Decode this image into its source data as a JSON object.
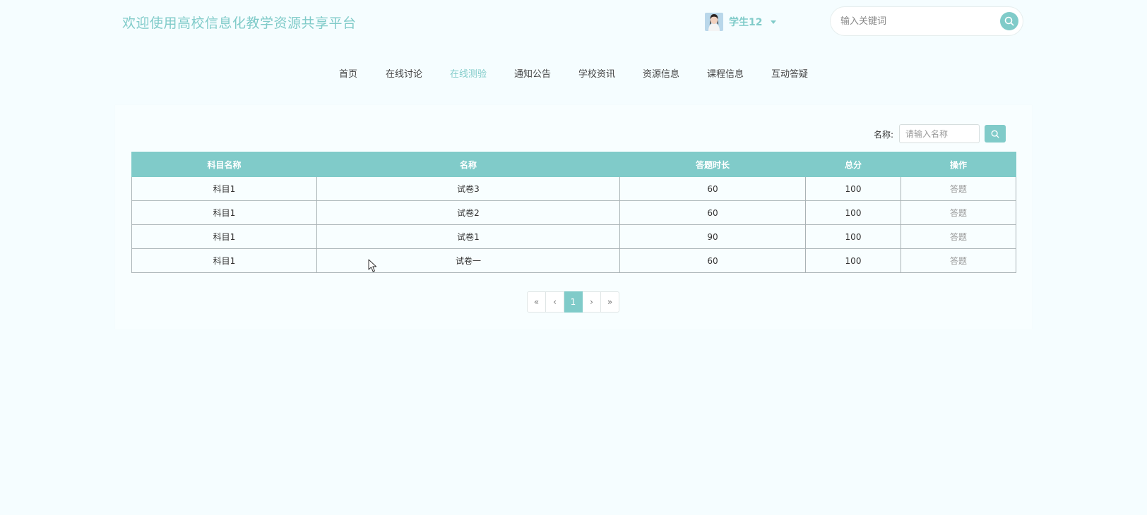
{
  "header": {
    "site_title": "欢迎使用高校信息化教学资源共享平台",
    "user": {
      "name": "学生12",
      "avatar_icon": "user-avatar"
    },
    "search": {
      "placeholder": "输入关键词",
      "value": "",
      "icon": "search-icon"
    }
  },
  "nav": {
    "items": [
      {
        "label": "首页",
        "active": false
      },
      {
        "label": "在线讨论",
        "active": false
      },
      {
        "label": "在线测验",
        "active": true
      },
      {
        "label": "通知公告",
        "active": false
      },
      {
        "label": "学校资讯",
        "active": false
      },
      {
        "label": "资源信息",
        "active": false
      },
      {
        "label": "课程信息",
        "active": false
      },
      {
        "label": "互动答疑",
        "active": false
      }
    ]
  },
  "filter": {
    "label": "名称:",
    "placeholder": "请输入名称",
    "value": ""
  },
  "table": {
    "columns": [
      "科目名称",
      "名称",
      "答题时长",
      "总分",
      "操作"
    ],
    "rows": [
      {
        "subject": "科目1",
        "name": "试卷3",
        "duration": "60",
        "score": "100",
        "action": "答题"
      },
      {
        "subject": "科目1",
        "name": "试卷2",
        "duration": "60",
        "score": "100",
        "action": "答题"
      },
      {
        "subject": "科目1",
        "name": "试卷1",
        "duration": "90",
        "score": "100",
        "action": "答题"
      },
      {
        "subject": "科目1",
        "name": "试卷一",
        "duration": "60",
        "score": "100",
        "action": "答题"
      }
    ]
  },
  "pagination": {
    "first": "«",
    "prev": "‹",
    "current": "1",
    "next": "›",
    "last": "»"
  },
  "colors": {
    "accent": "#80cbc9",
    "background": "#f5fdff"
  }
}
